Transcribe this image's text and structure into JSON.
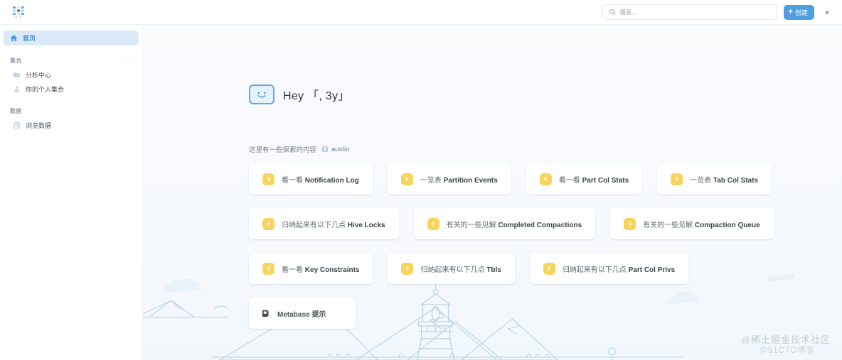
{
  "topnav": {
    "logo_icon": "metabase-dots-logo",
    "search": {
      "icon": "search-icon",
      "placeholder": "搜索...",
      "value": ""
    },
    "create_button": {
      "icon": "plus-icon",
      "label": "创建"
    },
    "settings_icon": "gear-icon"
  },
  "sidebar": {
    "home": {
      "label": "首页",
      "icon": "home-icon",
      "active": true
    },
    "collections_section": {
      "label": "集合",
      "menu_icon": "ellipsis-icon",
      "items": [
        {
          "label": "分析中心",
          "icon": "folder-icon"
        },
        {
          "label": "你的个人集合",
          "icon": "person-icon"
        }
      ]
    },
    "data_section": {
      "label": "数据",
      "items": [
        {
          "label": "浏览数据",
          "icon": "database-icon"
        }
      ]
    }
  },
  "main": {
    "greeting": {
      "icon": "smiling-face-icon",
      "text": "Hey 「, 3y」"
    },
    "explore": {
      "label": "这里有一些探索的内容",
      "database_icon": "database-icon",
      "database_name": "austin"
    },
    "card_rows": [
      [
        {
          "cn": "看一看",
          "en": "Notification Log",
          "icon": "bolt-icon"
        },
        {
          "cn": "一览表",
          "en": "Partition Events",
          "icon": "bolt-icon"
        },
        {
          "cn": "看一看",
          "en": "Part Col Stats",
          "icon": "bolt-icon"
        },
        {
          "cn": "一览表",
          "en": "Tab Col Stats",
          "icon": "bolt-icon"
        }
      ],
      [
        {
          "cn": "归纳起来有以下几点",
          "en": "Hive Locks",
          "icon": "bolt-icon"
        },
        {
          "cn": "有关的一些见解",
          "en": "Completed Compactions",
          "icon": "bolt-icon"
        },
        {
          "cn": "有关的一些见解",
          "en": "Compaction Queue",
          "icon": "bolt-icon"
        }
      ],
      [
        {
          "cn": "看一看",
          "en": "Key Constraints",
          "icon": "bolt-icon"
        },
        {
          "cn": "归纳起来有以下几点",
          "en": "Tbls",
          "icon": "bolt-icon"
        },
        {
          "cn": "归纳起来有以下几点",
          "en": "Part Col Privs",
          "icon": "bolt-icon"
        }
      ]
    ],
    "tip_card": {
      "icon": "book-icon",
      "label": "Metabase 提示"
    },
    "illustration": "mountains-clouds-lighthouse-line-art"
  },
  "watermarks": {
    "primary": "@稀土掘金技术社区",
    "secondary": "@51CTO博客"
  },
  "colors": {
    "brand_blue": "#509ee3",
    "accent_yellow": "#f9d45c",
    "sidebar_active_bg": "#dbe9f8",
    "illustration_line": "#a8c6e6"
  }
}
